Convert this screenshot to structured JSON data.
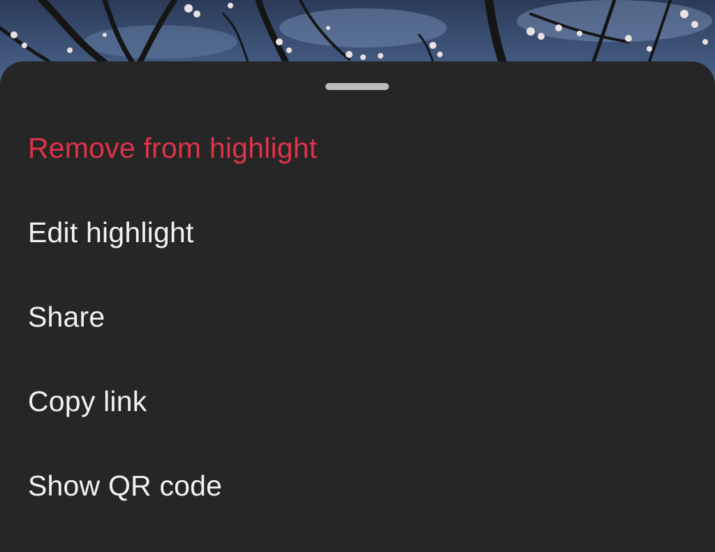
{
  "backdrop": {
    "description_icon": "blossom-tree-photo"
  },
  "sheet": {
    "colors": {
      "background": "#262626",
      "text": "#f2f2f2",
      "destructive": "#e0334a",
      "handle": "#bdbdbd"
    },
    "items": [
      {
        "label": "Remove from highlight",
        "style": "destructive"
      },
      {
        "label": "Edit highlight",
        "style": "default"
      },
      {
        "label": "Share",
        "style": "default"
      },
      {
        "label": "Copy link",
        "style": "default"
      },
      {
        "label": "Show QR code",
        "style": "default"
      }
    ]
  }
}
